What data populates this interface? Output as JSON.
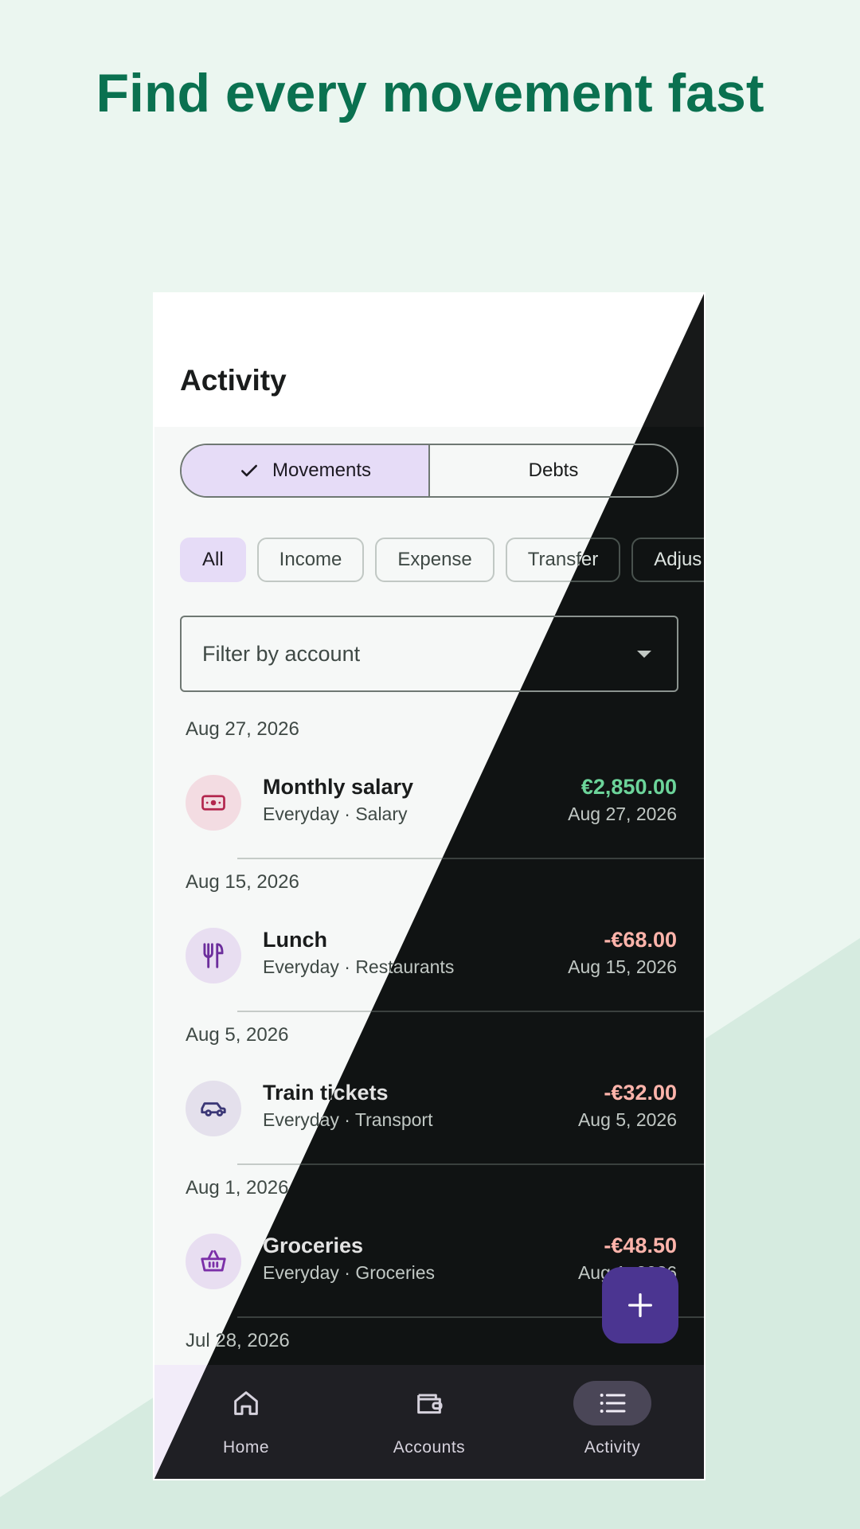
{
  "hero": {
    "title": "Find every movement fast"
  },
  "colors": {
    "background": "#ebf6f0",
    "accent_triangle": "#d6ebe0",
    "hero_text": "#0a7150",
    "fab": "#4b3591",
    "income": "#6cd49a",
    "expense": "#f3a3a0"
  },
  "app": {
    "title": "Activity",
    "segments": [
      {
        "label": "Movements",
        "selected": true
      },
      {
        "label": "Debts",
        "selected": false
      }
    ],
    "chips": [
      {
        "label": "All",
        "selected": true
      },
      {
        "label": "Income",
        "selected": false
      },
      {
        "label": "Expense",
        "selected": false
      },
      {
        "label": "Transfer",
        "selected": false
      },
      {
        "label": "Adjus",
        "selected": false
      }
    ],
    "filter": {
      "placeholder": "Filter by account"
    },
    "groups": [
      {
        "date": "Aug 27, 2026",
        "item": {
          "title": "Monthly salary",
          "subtitle": "Everyday · Salary",
          "amount": "€2,850.00",
          "date": "Aug 27, 2026",
          "icon": "cash-icon",
          "type": "income"
        }
      },
      {
        "date": "Aug 15, 2026",
        "item": {
          "title": "Lunch",
          "subtitle": "Everyday · Restaurants",
          "amount": "-€68.00",
          "date": "Aug 15, 2026",
          "icon": "fork-knife-icon",
          "type": "expense"
        }
      },
      {
        "date": "Aug 5, 2026",
        "item": {
          "title": "Train tickets",
          "subtitle": "Everyday · Transport",
          "amount": "-€32.00",
          "date": "Aug 5, 2026",
          "icon": "car-icon",
          "type": "expense"
        }
      },
      {
        "date": "Aug 1, 2026",
        "item": {
          "title": "Groceries",
          "subtitle": "Everyday · Groceries",
          "amount": "-€48.50",
          "date": "Aug 1, 2026",
          "icon": "basket-icon",
          "type": "expense"
        }
      },
      {
        "date": "Jul 28, 2026"
      }
    ],
    "fab": {
      "icon": "plus-icon"
    },
    "nav": [
      {
        "label": "Home",
        "icon": "home-icon",
        "active": false
      },
      {
        "label": "Accounts",
        "icon": "wallet-icon",
        "active": false
      },
      {
        "label": "Activity",
        "icon": "list-icon",
        "active": true
      }
    ]
  }
}
